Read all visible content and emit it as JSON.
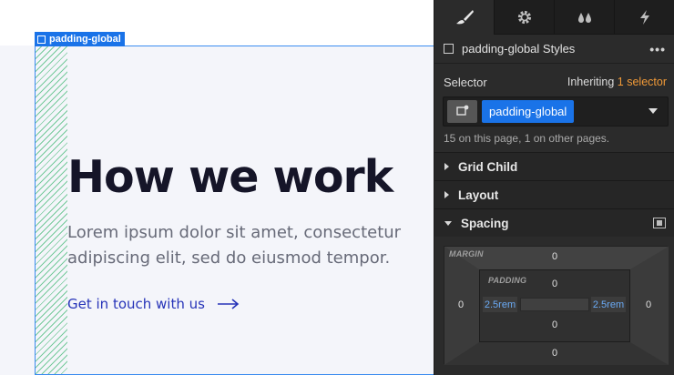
{
  "canvas": {
    "selection_tag": "padding-global",
    "heading": "How we work",
    "paragraph": "Lorem ipsum dolor sit amet, consectetur adipiscing elit, sed do eiusmod tempor.",
    "link": "Get in touch with us",
    "link_icon": "arrow-right-icon"
  },
  "panel": {
    "tabs": [
      {
        "icon": "brush-icon",
        "active": true
      },
      {
        "icon": "gear-icon",
        "active": false
      },
      {
        "icon": "drops-icon",
        "active": false
      },
      {
        "icon": "lightning-icon",
        "active": false
      }
    ],
    "styles_title": "padding-global Styles",
    "more_menu": "•••",
    "selector_label": "Selector",
    "inheriting_prefix": "Inheriting",
    "inheriting_count": "1 selector",
    "selector_chip": "padding-global",
    "usage_text": "15 on this page, 1 on other pages.",
    "sections": [
      "Grid Child",
      "Layout",
      "Spacing"
    ],
    "box_model": {
      "margin_label": "MARGIN",
      "padding_label": "PADDING",
      "margin_top": "0",
      "margin_right": "0",
      "margin_bottom": "0",
      "margin_left": "0",
      "padding_top": "0",
      "padding_right": "2.5rem",
      "padding_bottom": "0",
      "padding_left": "2.5rem"
    }
  },
  "colors": {
    "accent_blue": "#1a73e8",
    "accent_orange": "#f19a38",
    "link_blue": "#2633b8",
    "panel_bg": "#2b2b2b",
    "padding_highlight": "#6aaaf5"
  }
}
